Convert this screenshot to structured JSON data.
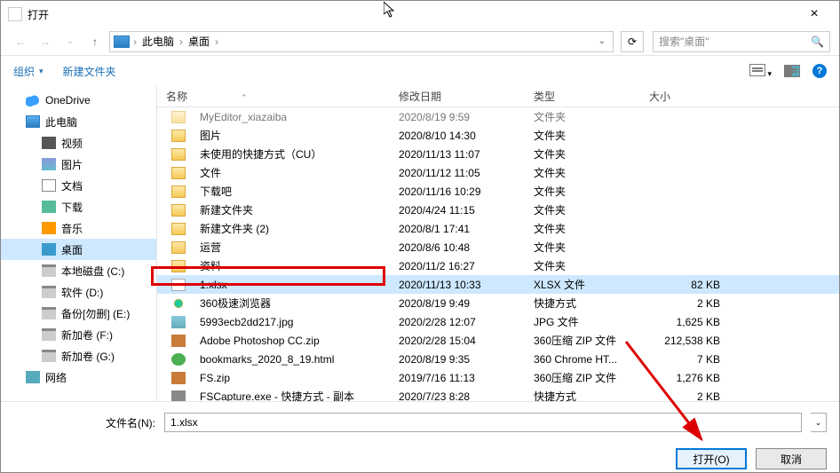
{
  "title": "打开",
  "breadcrumb": {
    "root": "此电脑",
    "folder": "桌面"
  },
  "search_placeholder": "搜索\"桌面\"",
  "toolbar": {
    "organize": "组织",
    "newfolder": "新建文件夹"
  },
  "sidebar": [
    {
      "label": "OneDrive",
      "icon": "i-cloud",
      "child": false
    },
    {
      "label": "此电脑",
      "icon": "i-pc",
      "child": false
    },
    {
      "label": "视频",
      "icon": "i-video",
      "child": true
    },
    {
      "label": "图片",
      "icon": "i-pic",
      "child": true
    },
    {
      "label": "文档",
      "icon": "i-doc",
      "child": true
    },
    {
      "label": "下载",
      "icon": "i-down",
      "child": true
    },
    {
      "label": "音乐",
      "icon": "i-music",
      "child": true
    },
    {
      "label": "桌面",
      "icon": "i-desk",
      "child": true,
      "selected": true
    },
    {
      "label": "本地磁盘 (C:)",
      "icon": "i-drive",
      "child": true
    },
    {
      "label": "软件 (D:)",
      "icon": "i-drive",
      "child": true
    },
    {
      "label": "备份[勿删] (E:)",
      "icon": "i-drive",
      "child": true
    },
    {
      "label": "新加卷 (F:)",
      "icon": "i-drive",
      "child": true
    },
    {
      "label": "新加卷 (G:)",
      "icon": "i-drive",
      "child": true
    },
    {
      "label": "网络",
      "icon": "i-net",
      "child": false
    }
  ],
  "columns": {
    "name": "名称",
    "date": "修改日期",
    "type": "类型",
    "size": "大小"
  },
  "rows": [
    {
      "name": "MyEditor_xiazaiba",
      "date": "2020/8/19 9:59",
      "type": "文件夹",
      "size": "",
      "icon": "f-folder",
      "cut": true
    },
    {
      "name": "图片",
      "date": "2020/8/10 14:30",
      "type": "文件夹",
      "size": "",
      "icon": "f-folder"
    },
    {
      "name": "未使用的快捷方式（CU）",
      "date": "2020/11/13 11:07",
      "type": "文件夹",
      "size": "",
      "icon": "f-folder"
    },
    {
      "name": "文件",
      "date": "2020/11/12 11:05",
      "type": "文件夹",
      "size": "",
      "icon": "f-folder"
    },
    {
      "name": "下载吧",
      "date": "2020/11/16 10:29",
      "type": "文件夹",
      "size": "",
      "icon": "f-folder"
    },
    {
      "name": "新建文件夹",
      "date": "2020/4/24 11:15",
      "type": "文件夹",
      "size": "",
      "icon": "f-folder"
    },
    {
      "name": "新建文件夹 (2)",
      "date": "2020/8/1 17:41",
      "type": "文件夹",
      "size": "",
      "icon": "f-folder"
    },
    {
      "name": "运营",
      "date": "2020/8/6 10:48",
      "type": "文件夹",
      "size": "",
      "icon": "f-folder"
    },
    {
      "name": "资料",
      "date": "2020/11/2 16:27",
      "type": "文件夹",
      "size": "",
      "icon": "f-folder"
    },
    {
      "name": "1.xlsx",
      "date": "2020/11/13 10:33",
      "type": "XLSX 文件",
      "size": "82 KB",
      "icon": "f-file",
      "selected": true
    },
    {
      "name": "360极速浏览器",
      "date": "2020/8/19 9:49",
      "type": "快捷方式",
      "size": "2 KB",
      "icon": "f-360"
    },
    {
      "name": "5993ecb2dd217.jpg",
      "date": "2020/2/28 12:07",
      "type": "JPG 文件",
      "size": "1,625 KB",
      "icon": "f-img"
    },
    {
      "name": "Adobe Photoshop CC.zip",
      "date": "2020/2/28 15:04",
      "type": "360压缩 ZIP 文件",
      "size": "212,538 KB",
      "icon": "f-zip"
    },
    {
      "name": "bookmarks_2020_8_19.html",
      "date": "2020/8/19 9:35",
      "type": "360 Chrome HT...",
      "size": "7 KB",
      "icon": "f-html"
    },
    {
      "name": "FS.zip",
      "date": "2019/7/16 11:13",
      "type": "360压缩 ZIP 文件",
      "size": "1,276 KB",
      "icon": "f-zip"
    },
    {
      "name": "FSCapture.exe - 快捷方式 - 副本",
      "date": "2020/7/23 8:28",
      "type": "快捷方式",
      "size": "2 KB",
      "icon": "f-exe"
    }
  ],
  "filename": {
    "label": "文件名(N):",
    "value": "1.xlsx"
  },
  "buttons": {
    "open": "打开(O)",
    "cancel": "取消"
  }
}
